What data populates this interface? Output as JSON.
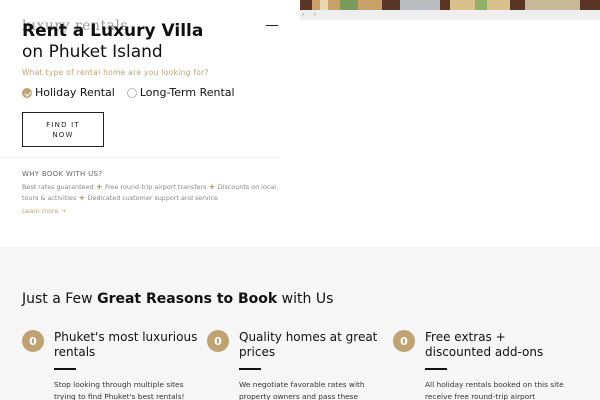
{
  "header": {
    "logo_text": "luxury rentals",
    "menu_icon": "hamburger-icon"
  },
  "hero": {
    "title_bold": "Rent a Luxury Villa",
    "title_rest": "on Phuket Island",
    "question": "What type of rental home are you looking for?",
    "options": [
      {
        "label": "Holiday Rental",
        "checked": true
      },
      {
        "label": "Long-Term Rental",
        "checked": false
      }
    ],
    "cta_label": "FIND IT NOW"
  },
  "why_book": {
    "title": "WHY BOOK WITH US?",
    "items": [
      "Best rates guaranteed",
      "Free round-trip airport transfers",
      "Discounts on local tours & activities",
      "Dedicated customer support and service"
    ],
    "learn_more": "Learn more →"
  },
  "image_nav": {
    "prev": "›",
    "next": "‹"
  },
  "reasons": {
    "title_pre": "Just a Few ",
    "title_bold": "Great Reasons to Book",
    "title_post": " with Us",
    "items": [
      {
        "badge": "0",
        "title": "Phuket's most luxurious rentals",
        "text": "Stop looking through multiple sites trying to find Phuket's best rentals!"
      },
      {
        "badge": "0",
        "title": "Quality homes at great prices",
        "text": "We negotiate favorable rates with property owners and pass these"
      },
      {
        "badge": "0",
        "title": "Free extras + discounted add-ons",
        "text": "All holiday rentals booked on this site receive free round-trip airport"
      }
    ]
  },
  "colors": {
    "accent": "#c0a272",
    "section_bg": "#f6f6f6",
    "text": "#111111"
  }
}
